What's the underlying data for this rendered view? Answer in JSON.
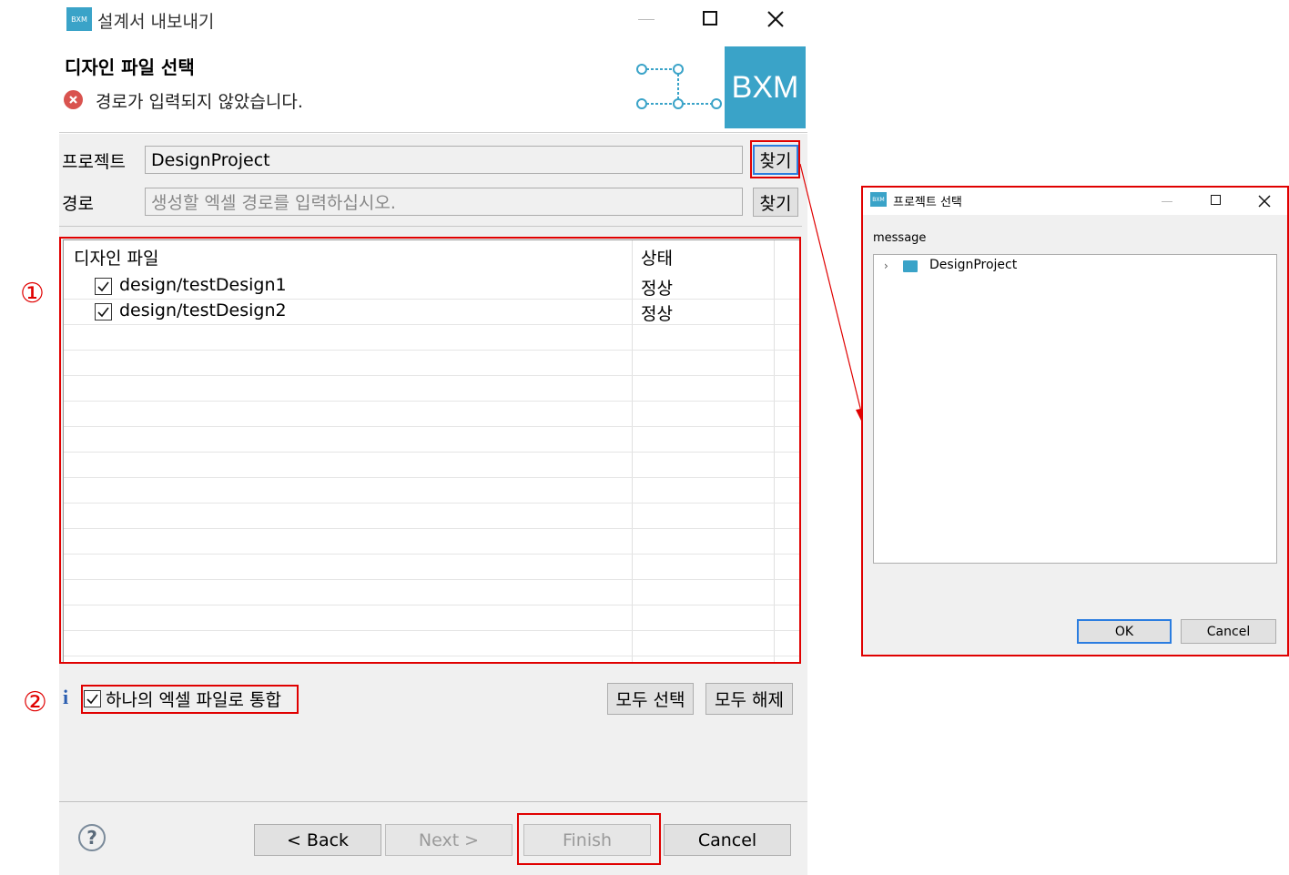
{
  "main_dialog": {
    "logo_text": "BXM",
    "title": "설계서 내보내기",
    "page_title": "디자인 파일 선택",
    "error_message": "경로가 입력되지 않았습니다.",
    "banner_logo_text": "BXM",
    "project_label": "프로젝트",
    "project_value": "DesignProject",
    "browse_label": "찾기",
    "path_label": "경로",
    "path_placeholder": "생성할 엑셀 경로를 입력하십시오.",
    "table": {
      "col_file": "디자인 파일",
      "col_status": "상태",
      "rows": [
        {
          "file": "design/testDesign1",
          "status": "정상",
          "checked": true
        },
        {
          "file": "design/testDesign2",
          "status": "정상",
          "checked": true
        }
      ]
    },
    "merge_label": "하나의 엑셀 파일로 통합",
    "select_all": "모두 선택",
    "deselect_all": "모두 해제",
    "back": "< Back",
    "next": "Next >",
    "finish": "Finish",
    "cancel": "Cancel"
  },
  "annotations": {
    "marker1": "①",
    "marker2": "②"
  },
  "project_dialog": {
    "logo_text": "BXM",
    "title": "프로젝트 선택",
    "message": "message",
    "tree_item": "DesignProject",
    "ok": "OK",
    "cancel": "Cancel"
  },
  "colors": {
    "annotation_red": "#e00000",
    "accent_blue": "#3aa3c8",
    "dialog_bg": "#f0f0f0"
  }
}
